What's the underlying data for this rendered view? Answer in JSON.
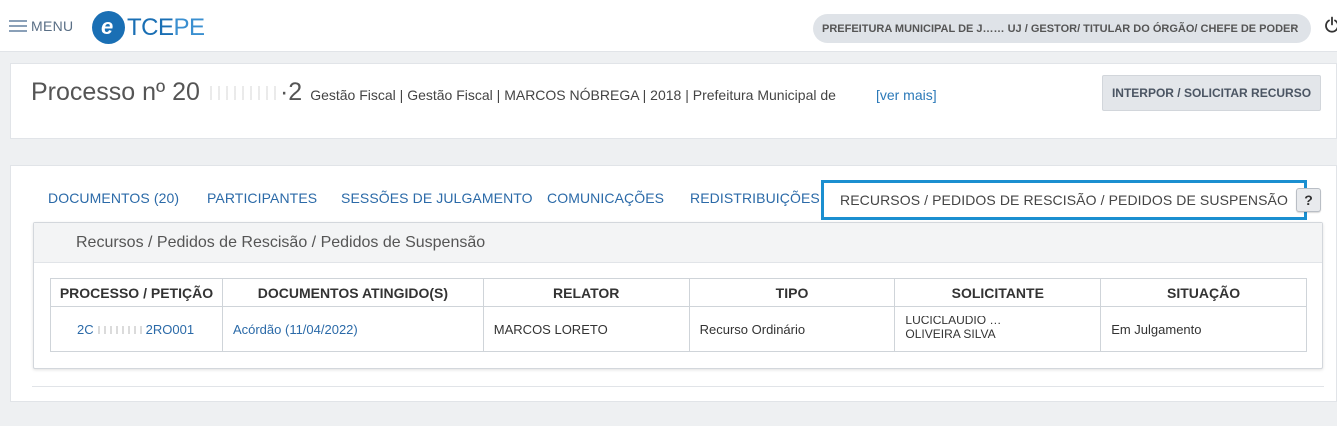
{
  "topbar": {
    "menu_label": "MENU",
    "logo": {
      "e": "e",
      "text_a": "TCE",
      "text_b": "PE"
    },
    "profile_label": "PREFEITURA MUNICIPAL DE J…… UJ / GESTOR/ TITULAR DO ÓRGÃO/ CHEFE DE PODER",
    "icons": {
      "menu": "hamburger-icon",
      "chevron": "chevron-down-icon",
      "power": "power-icon"
    }
  },
  "process": {
    "title_prefix": "Processo nº 20",
    "title_suffix": "·2",
    "meta": "Gestão Fiscal | Gestão Fiscal | MARCOS NÓBREGA | 2018 | Prefeitura Municipal de",
    "more_link": "[ver mais]",
    "action_button": "INTERPOR / SOLICITAR RECURSO"
  },
  "tabs": [
    {
      "label": "DOCUMENTOS (20)"
    },
    {
      "label": "PARTICIPANTES"
    },
    {
      "label": "SESSÕES DE JULGAMENTO"
    },
    {
      "label": "COMUNICAÇÕES"
    },
    {
      "label": "REDISTRIBUIÇÕES"
    },
    {
      "label": "RECURSOS / PEDIDOS DE RESCISÃO / PEDIDOS DE SUSPENSÃO",
      "active": true
    }
  ],
  "help_label": "?",
  "panel": {
    "title": "Recursos / Pedidos de Rescisão / Pedidos de Suspensão",
    "columns": [
      "PROCESSO / PETIÇÃO",
      "DOCUMENTOS ATINGIDO(S)",
      "RELATOR",
      "TIPO",
      "SOLICITANTE",
      "SITUAÇÃO"
    ],
    "rows": [
      {
        "processo_a": "2C",
        "processo_b": "2RO001",
        "documentos": "Acórdão (11/04/2022)",
        "relator": "MARCOS LORETO",
        "tipo": "Recurso Ordinário",
        "solicitante_a": "LUCICLAUDIO …",
        "solicitante_b": "OLIVEIRA SILVA",
        "situacao": "Em Julgamento"
      }
    ]
  },
  "colors": {
    "accent": "#1b8fd0",
    "link": "#2b6aa8",
    "brand": "#1a6fb4"
  }
}
